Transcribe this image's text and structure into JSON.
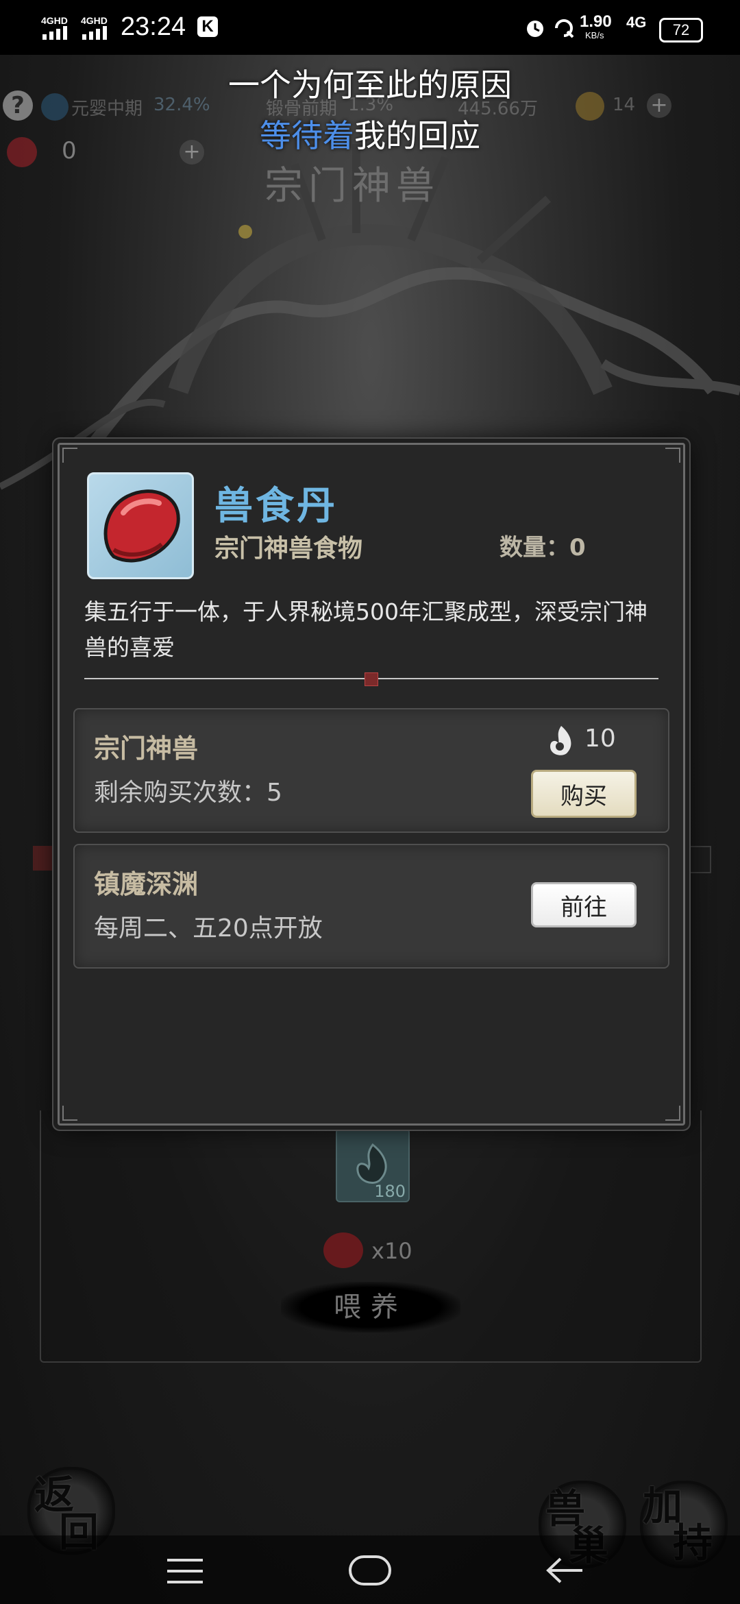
{
  "status_bar": {
    "network1": "4GHD",
    "network2": "4GHD",
    "time": "23:24",
    "app_badge": "K",
    "speed_value": "1.90",
    "speed_unit": "KB/s",
    "network3": "4G",
    "battery": "72"
  },
  "lyrics": {
    "line1": "一个为何至此的原因",
    "line2_highlight": "等待着",
    "line2_rest": "我的回应"
  },
  "resource_bar": {
    "realm": "元婴中期",
    "realm_pct": "32.4%",
    "realm2": "锻骨前期",
    "realm2_pct": "1.3%",
    "currency": "445.66万",
    "tokens": "14",
    "food_count": "0"
  },
  "scene": {
    "title": "宗门神兽"
  },
  "dialog": {
    "item_name": "兽食丹",
    "item_type": "宗门神兽食物",
    "quantity_label": "数量：",
    "quantity_value": "0",
    "description": "集五行于一体，于人界秘境500年汇聚成型，深受宗门神兽的喜爱",
    "sources": [
      {
        "title": "宗门神兽",
        "subtitle": "剩余购买次数：5",
        "cost": "10",
        "button": "购买"
      },
      {
        "title": "镇魔深渊",
        "subtitle": "每周二、五20点开放",
        "button": "前往"
      }
    ]
  },
  "feed_area": {
    "item_count": "180",
    "cost_multiplier": "x10",
    "feed_button": "喂养"
  },
  "bottom_buttons": {
    "back_top": "返",
    "back_bottom": "回",
    "nest_top": "兽",
    "nest_bottom": "巢",
    "buff_top": "加",
    "buff_bottom": "持"
  },
  "colors": {
    "item_name": "#6fb6e2",
    "panel_title": "#c7bca3",
    "lyric_highlight": "#4d8fea"
  },
  "icons": [
    "help-icon",
    "realm-icon",
    "currency-icon",
    "token-icon",
    "plus-icon",
    "food-pill-icon",
    "spirit-flame-icon",
    "menu-icon",
    "home-icon",
    "back-icon"
  ]
}
